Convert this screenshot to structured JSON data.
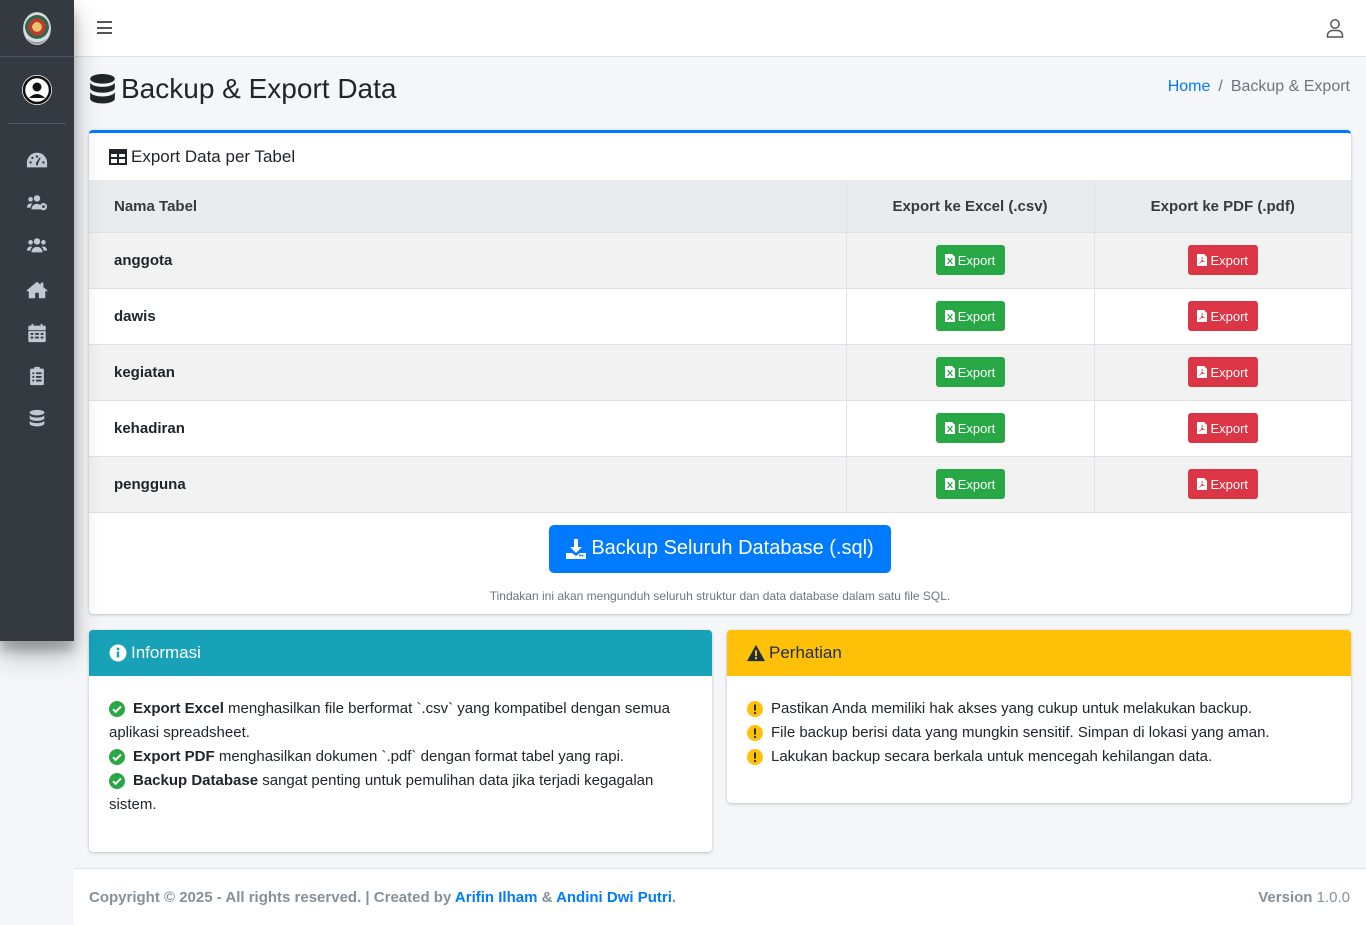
{
  "page": {
    "title": "Backup & Export Data",
    "breadcrumb_home": "Home",
    "breadcrumb_current": "Backup & Export"
  },
  "sidebar": {
    "items": [
      {
        "icon": "tachometer-icon"
      },
      {
        "icon": "users-cog-icon"
      },
      {
        "icon": "users-icon"
      },
      {
        "icon": "home-icon"
      },
      {
        "icon": "calendar-icon"
      },
      {
        "icon": "clipboard-icon"
      },
      {
        "icon": "database-icon"
      }
    ]
  },
  "export_card": {
    "title": "Export Data per Tabel",
    "headers": {
      "table_name": "Nama Tabel",
      "excel": "Export ke Excel (.csv)",
      "pdf": "Export ke PDF (.pdf)"
    },
    "rows": [
      {
        "name": "anggota",
        "excel_label": "Export",
        "pdf_label": "Export"
      },
      {
        "name": "dawis",
        "excel_label": "Export",
        "pdf_label": "Export"
      },
      {
        "name": "kegiatan",
        "excel_label": "Export",
        "pdf_label": "Export"
      },
      {
        "name": "kehadiran",
        "excel_label": "Export",
        "pdf_label": "Export"
      },
      {
        "name": "pengguna",
        "excel_label": "Export",
        "pdf_label": "Export"
      }
    ],
    "backup_button": "Backup Seluruh Database (.sql)",
    "backup_note": "Tindakan ini akan mengunduh seluruh struktur dan data database dalam satu file SQL."
  },
  "info_card": {
    "title": "Informasi",
    "items": [
      {
        "bold": "Export Excel",
        "text": " menghasilkan file berformat `.csv` yang kompatibel dengan semua aplikasi spreadsheet."
      },
      {
        "bold": "Export PDF",
        "text": " menghasilkan dokumen `.pdf` dengan format tabel yang rapi."
      },
      {
        "bold": "Backup Database",
        "text": " sangat penting untuk pemulihan data jika terjadi kegagalan sistem."
      }
    ]
  },
  "warning_card": {
    "title": "Perhatian",
    "items": [
      "Pastikan Anda memiliki hak akses yang cukup untuk melakukan backup.",
      "File backup berisi data yang mungkin sensitif. Simpan di lokasi yang aman.",
      "Lakukan backup secara berkala untuk mencegah kehilangan data."
    ]
  },
  "footer": {
    "copyright": "Copyright © 2025 - All rights reserved. | Created by ",
    "author1": "Arifin Ilham",
    "amp": " & ",
    "author2": "Andini Dwi Putri",
    "dot": ".",
    "version_label": "Version",
    "version": "1.0.0"
  },
  "colors": {
    "primary": "#007bff",
    "success": "#28a745",
    "danger": "#dc3545",
    "info": "#17a2b8",
    "warning": "#ffc107",
    "sidebar": "#343a40"
  }
}
